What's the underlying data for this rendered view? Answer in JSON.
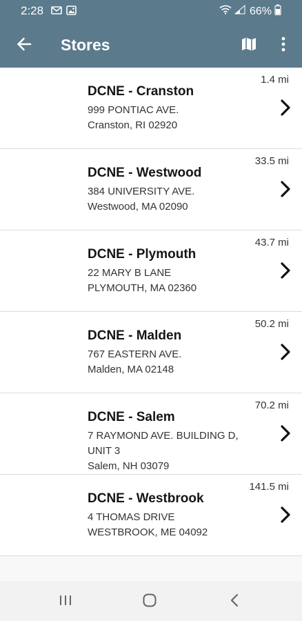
{
  "status_bar": {
    "time": "2:28",
    "battery": "66%"
  },
  "app_bar": {
    "title": "Stores",
    "background_color": "#5b7a8c"
  },
  "stores": [
    {
      "name": "DCNE - Cranston",
      "address_line1": "999 PONTIAC AVE.",
      "address_line2": "Cranston, RI 02920",
      "distance": "1.4 mi"
    },
    {
      "name": "DCNE - Westwood",
      "address_line1": "384 UNIVERSITY AVE.",
      "address_line2": "Westwood, MA 02090",
      "distance": "33.5 mi"
    },
    {
      "name": "DCNE - Plymouth",
      "address_line1": "22 MARY B LANE",
      "address_line2": "PLYMOUTH, MA 02360",
      "distance": "43.7 mi"
    },
    {
      "name": "DCNE - Malden",
      "address_line1": "767 EASTERN AVE.",
      "address_line2": "Malden, MA 02148",
      "distance": "50.2 mi"
    },
    {
      "name": "DCNE - Salem",
      "address_line1": "7 RAYMOND AVE. BUILDING D, UNIT 3",
      "address_line2": "Salem, NH 03079",
      "distance": "70.2 mi"
    },
    {
      "name": "DCNE - Westbrook",
      "address_line1": "4 THOMAS DRIVE",
      "address_line2": "WESTBROOK, ME 04092",
      "distance": "141.5 mi"
    }
  ]
}
